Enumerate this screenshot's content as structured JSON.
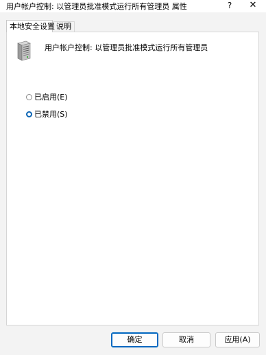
{
  "window": {
    "title": "用户帐户控制: 以管理员批准模式运行所有管理员 属性",
    "help_glyph": "?",
    "close_glyph": "✕"
  },
  "tabs": [
    {
      "label": "本地安全设置",
      "active": true
    },
    {
      "label": "说明",
      "active": false
    }
  ],
  "policy": {
    "icon": "server-icon",
    "name": "用户帐户控制: 以管理员批准模式运行所有管理员"
  },
  "options": [
    {
      "label": "已启用(E)",
      "checked": false
    },
    {
      "label": "已禁用(S)",
      "checked": true
    }
  ],
  "buttons": {
    "ok": "确定",
    "cancel": "取消",
    "apply": "应用(A)"
  },
  "colors": {
    "accent": "#0067c0"
  }
}
